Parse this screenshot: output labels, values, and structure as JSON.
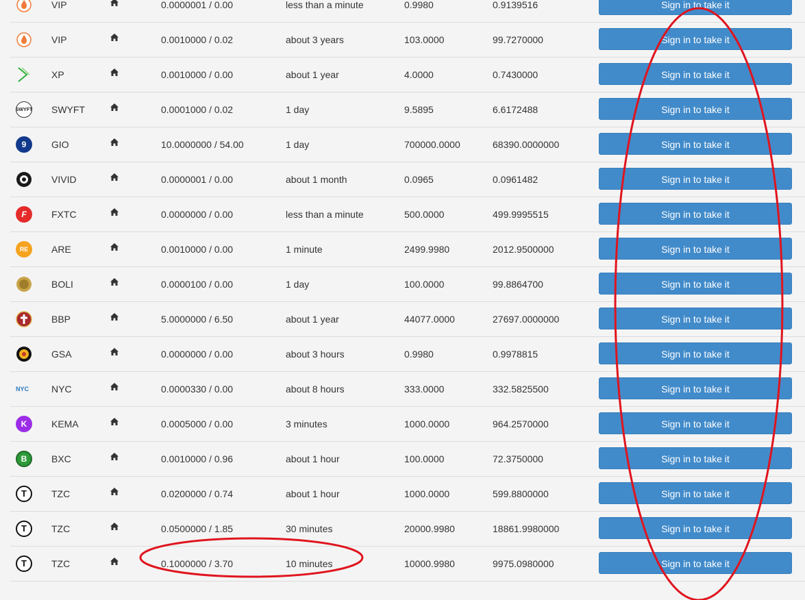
{
  "button_label": "Sign in to take it",
  "rows": [
    {
      "symbol": "VIP",
      "icon": "vip-flame-icon",
      "amount": "0.0000001 / 0.00",
      "time": "less than a minute",
      "total": "0.9980",
      "remaining": "0.9139516"
    },
    {
      "symbol": "VIP",
      "icon": "vip-flame-icon",
      "amount": "0.0010000 / 0.02",
      "time": "about 3 years",
      "total": "103.0000",
      "remaining": "99.7270000"
    },
    {
      "symbol": "XP",
      "icon": "xp-arrow-icon",
      "amount": "0.0010000 / 0.00",
      "time": "about 1 year",
      "total": "4.0000",
      "remaining": "0.7430000"
    },
    {
      "symbol": "SWYFT",
      "icon": "swyft-network-icon",
      "amount": "0.0001000 / 0.02",
      "time": "1 day",
      "total": "9.5895",
      "remaining": "6.6172488"
    },
    {
      "symbol": "GIO",
      "icon": "gio-icon",
      "amount": "10.0000000 / 54.00",
      "time": "1 day",
      "total": "700000.0000",
      "remaining": "68390.0000000"
    },
    {
      "symbol": "VIVID",
      "icon": "vivid-icon",
      "amount": "0.0000001 / 0.00",
      "time": "about 1 month",
      "total": "0.0965",
      "remaining": "0.0961482"
    },
    {
      "symbol": "FXTC",
      "icon": "fxtc-icon",
      "amount": "0.0000000 / 0.00",
      "time": "less than a minute",
      "total": "500.0000",
      "remaining": "499.9995515"
    },
    {
      "symbol": "ARE",
      "icon": "are-icon",
      "amount": "0.0010000 / 0.00",
      "time": "1 minute",
      "total": "2499.9980",
      "remaining": "2012.9500000"
    },
    {
      "symbol": "BOLI",
      "icon": "boli-coin-icon",
      "amount": "0.0000100 / 0.00",
      "time": "1 day",
      "total": "100.0000",
      "remaining": "99.8864700"
    },
    {
      "symbol": "BBP",
      "icon": "bbp-cross-icon",
      "amount": "5.0000000 / 6.50",
      "time": "about 1 year",
      "total": "44077.0000",
      "remaining": "27697.0000000"
    },
    {
      "symbol": "GSA",
      "icon": "gsa-icon",
      "amount": "0.0000000 / 0.00",
      "time": "about 3 hours",
      "total": "0.9980",
      "remaining": "0.9978815"
    },
    {
      "symbol": "NYC",
      "icon": "nyc-icon",
      "amount": "0.0000330 / 0.00",
      "time": "about 8 hours",
      "total": "333.0000",
      "remaining": "332.5825500"
    },
    {
      "symbol": "KEMA",
      "icon": "kema-icon",
      "amount": "0.0005000 / 0.00",
      "time": "3 minutes",
      "total": "1000.0000",
      "remaining": "964.2570000"
    },
    {
      "symbol": "BXC",
      "icon": "bxc-bitcoin-icon",
      "amount": "0.0010000 / 0.96",
      "time": "about 1 hour",
      "total": "100.0000",
      "remaining": "72.3750000"
    },
    {
      "symbol": "TZC",
      "icon": "tzc-icon",
      "amount": "0.0200000 / 0.74",
      "time": "about 1 hour",
      "total": "1000.0000",
      "remaining": "599.8800000"
    },
    {
      "symbol": "TZC",
      "icon": "tzc-icon",
      "amount": "0.0500000 / 1.85",
      "time": "30 minutes",
      "total": "20000.9980",
      "remaining": "18861.9980000"
    },
    {
      "symbol": "TZC",
      "icon": "tzc-icon",
      "amount": "0.1000000 / 3.70",
      "time": "10 minutes",
      "total": "10000.9980",
      "remaining": "9975.0980000"
    }
  ],
  "icon_labels": {
    "swyft": "SWYFT",
    "nyc": "NYC",
    "are": "RE",
    "gio": "9",
    "kema": "K",
    "bxc": "B",
    "tzc": "T",
    "fxtc": "F"
  },
  "colors": {
    "button": "#428bca",
    "annotation": "#e0141e",
    "row_border": "#dcdcdc"
  }
}
